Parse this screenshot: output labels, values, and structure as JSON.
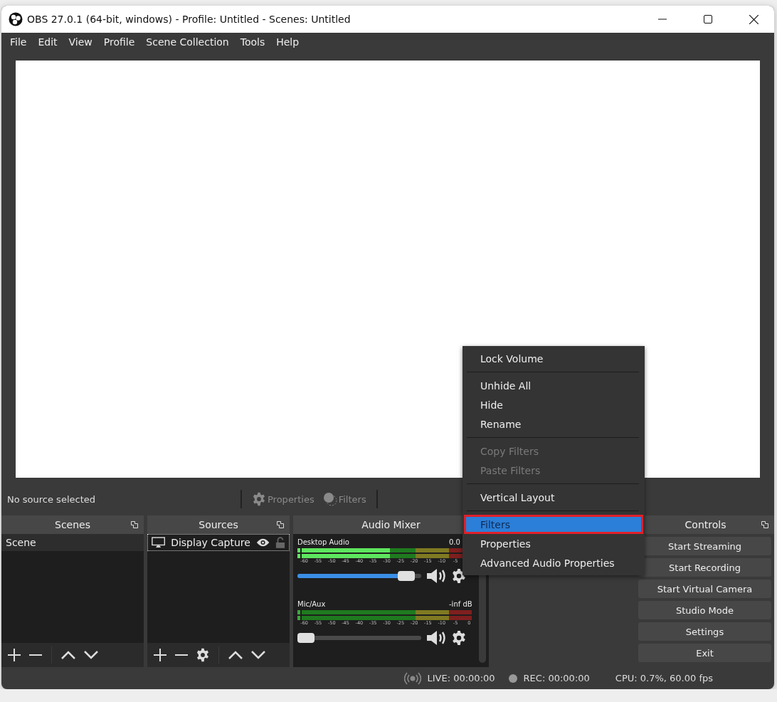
{
  "window": {
    "title": "OBS 27.0.1 (64-bit, windows) - Profile: Untitled - Scenes: Untitled"
  },
  "menu_bar": [
    "File",
    "Edit",
    "View",
    "Profile",
    "Scene Collection",
    "Tools",
    "Help"
  ],
  "source_toolbar": {
    "status": "No source selected",
    "buttons": [
      {
        "kind": "properties",
        "label": "Properties",
        "disabled": true
      },
      {
        "kind": "filters",
        "label": "Filters",
        "disabled": true
      }
    ]
  },
  "scenes": {
    "title": "Scenes",
    "items": [
      {
        "label": "Scene",
        "selected": true
      }
    ]
  },
  "sources": {
    "title": "Sources",
    "items": [
      {
        "label": "Display Capture",
        "visible": true,
        "locked": false
      }
    ]
  },
  "audio_mixer": {
    "title": "Audio Mixer",
    "channels": [
      {
        "name": "Desktop Audio",
        "reading": "0.0",
        "signal": true,
        "level": 0.94,
        "ticks": [
          "-60",
          "-55",
          "-50",
          "-45",
          "-40",
          "-35",
          "-30",
          "-25",
          "-20",
          "-15",
          "-10",
          "-5"
        ]
      },
      {
        "name": "Mic/Aux",
        "reading": "-inf dB",
        "signal": false,
        "level": 0,
        "ticks": [
          "-60",
          "-55",
          "-50",
          "-45",
          "-40",
          "-35",
          "-30",
          "-25",
          "-20",
          "-15",
          "-10",
          "-5",
          "0"
        ]
      }
    ]
  },
  "controls": {
    "title": "Controls",
    "buttons": [
      "Start Streaming",
      "Start Recording",
      "Start Virtual Camera",
      "Studio Mode",
      "Settings",
      "Exit"
    ]
  },
  "context_menu": [
    {
      "kind": "item",
      "label": "Lock Volume",
      "disabled": false,
      "selected": false,
      "outlined": false
    },
    {
      "kind": "separator"
    },
    {
      "kind": "item",
      "label": "Unhide All",
      "disabled": false,
      "selected": false,
      "outlined": false
    },
    {
      "kind": "item",
      "label": "Hide",
      "disabled": false,
      "selected": false,
      "outlined": false
    },
    {
      "kind": "item",
      "label": "Rename",
      "disabled": false,
      "selected": false,
      "outlined": false
    },
    {
      "kind": "separator"
    },
    {
      "kind": "item",
      "label": "Copy Filters",
      "disabled": true,
      "selected": false,
      "outlined": false
    },
    {
      "kind": "item",
      "label": "Paste Filters",
      "disabled": true,
      "selected": false,
      "outlined": false
    },
    {
      "kind": "separator"
    },
    {
      "kind": "item",
      "label": "Vertical Layout",
      "disabled": false,
      "selected": false,
      "outlined": false
    },
    {
      "kind": "separator"
    },
    {
      "kind": "item",
      "label": "Filters",
      "disabled": false,
      "selected": true,
      "outlined": true
    },
    {
      "kind": "item",
      "label": "Properties",
      "disabled": false,
      "selected": false,
      "outlined": false
    },
    {
      "kind": "item",
      "label": "Advanced Audio Properties",
      "disabled": false,
      "selected": false,
      "outlined": false
    }
  ],
  "status_bar": {
    "live": "LIVE: 00:00:00",
    "rec": "REC: 00:00:00",
    "cpu": "CPU: 0.7%, 60.00 fps"
  }
}
